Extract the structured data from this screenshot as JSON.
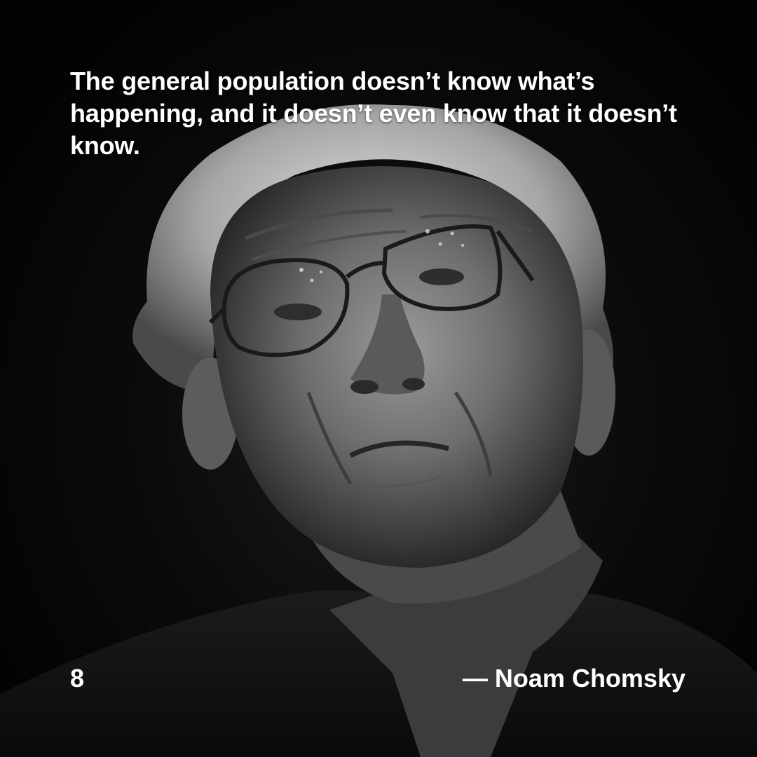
{
  "quote": {
    "text": "The general population doesn’t know what’s happening, and it doesn’t even know that it doesn’t know."
  },
  "footer": {
    "page_number": "8",
    "attribution": "— Noam Chomsky"
  },
  "colors": {
    "background": "#050505",
    "text": "#ffffff"
  }
}
